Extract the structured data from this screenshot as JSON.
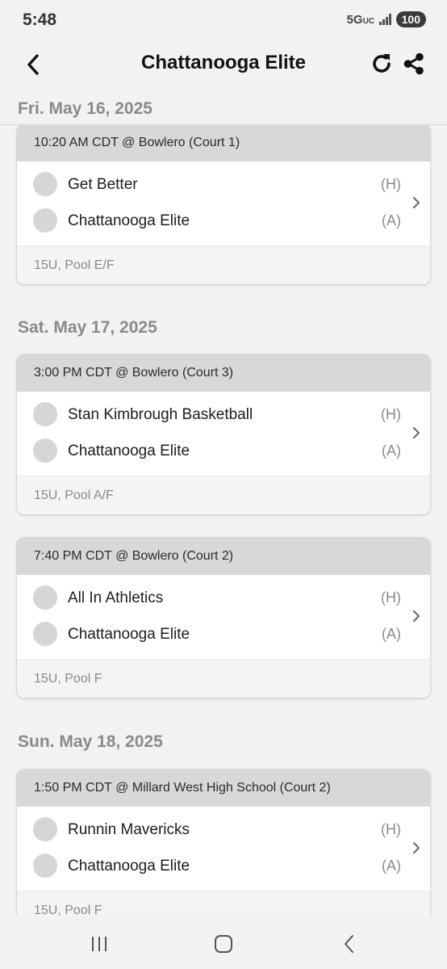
{
  "status": {
    "time": "5:48",
    "network": "5G",
    "network_sub": "UC",
    "battery": "100"
  },
  "header": {
    "title": "Chattanooga Elite",
    "back_icon": "chevron-left-icon",
    "refresh_icon": "refresh-icon",
    "share_icon": "share-icon"
  },
  "sections": [
    {
      "date": "Fri. May 16, 2025",
      "games": [
        {
          "time_location": "10:20 AM CDT @ Bowlero (Court 1)",
          "home": "Get Better",
          "home_tag": "(H)",
          "away": "Chattanooga Elite",
          "away_tag": "(A)",
          "division": "15U, Pool E/F"
        }
      ]
    },
    {
      "date": "Sat. May 17, 2025",
      "games": [
        {
          "time_location": "3:00 PM CDT @ Bowlero (Court 3)",
          "home": "Stan Kimbrough Basketball",
          "home_tag": "(H)",
          "away": "Chattanooga Elite",
          "away_tag": "(A)",
          "division": "15U, Pool A/F"
        },
        {
          "time_location": "7:40 PM CDT @ Bowlero (Court 2)",
          "home": "All In Athletics",
          "home_tag": "(H)",
          "away": "Chattanooga Elite",
          "away_tag": "(A)",
          "division": "15U, Pool F"
        }
      ]
    },
    {
      "date": "Sun. May 18, 2025",
      "games": [
        {
          "time_location": "1:50 PM CDT @ Millard West High School (Court 2)",
          "home": "Runnin Mavericks",
          "home_tag": "(H)",
          "away": "Chattanooga Elite",
          "away_tag": "(A)",
          "division": "15U, Pool F"
        }
      ]
    }
  ],
  "nav": {
    "recents_icon": "recent-apps-icon",
    "home_icon": "home-icon",
    "back_icon": "back-icon"
  }
}
